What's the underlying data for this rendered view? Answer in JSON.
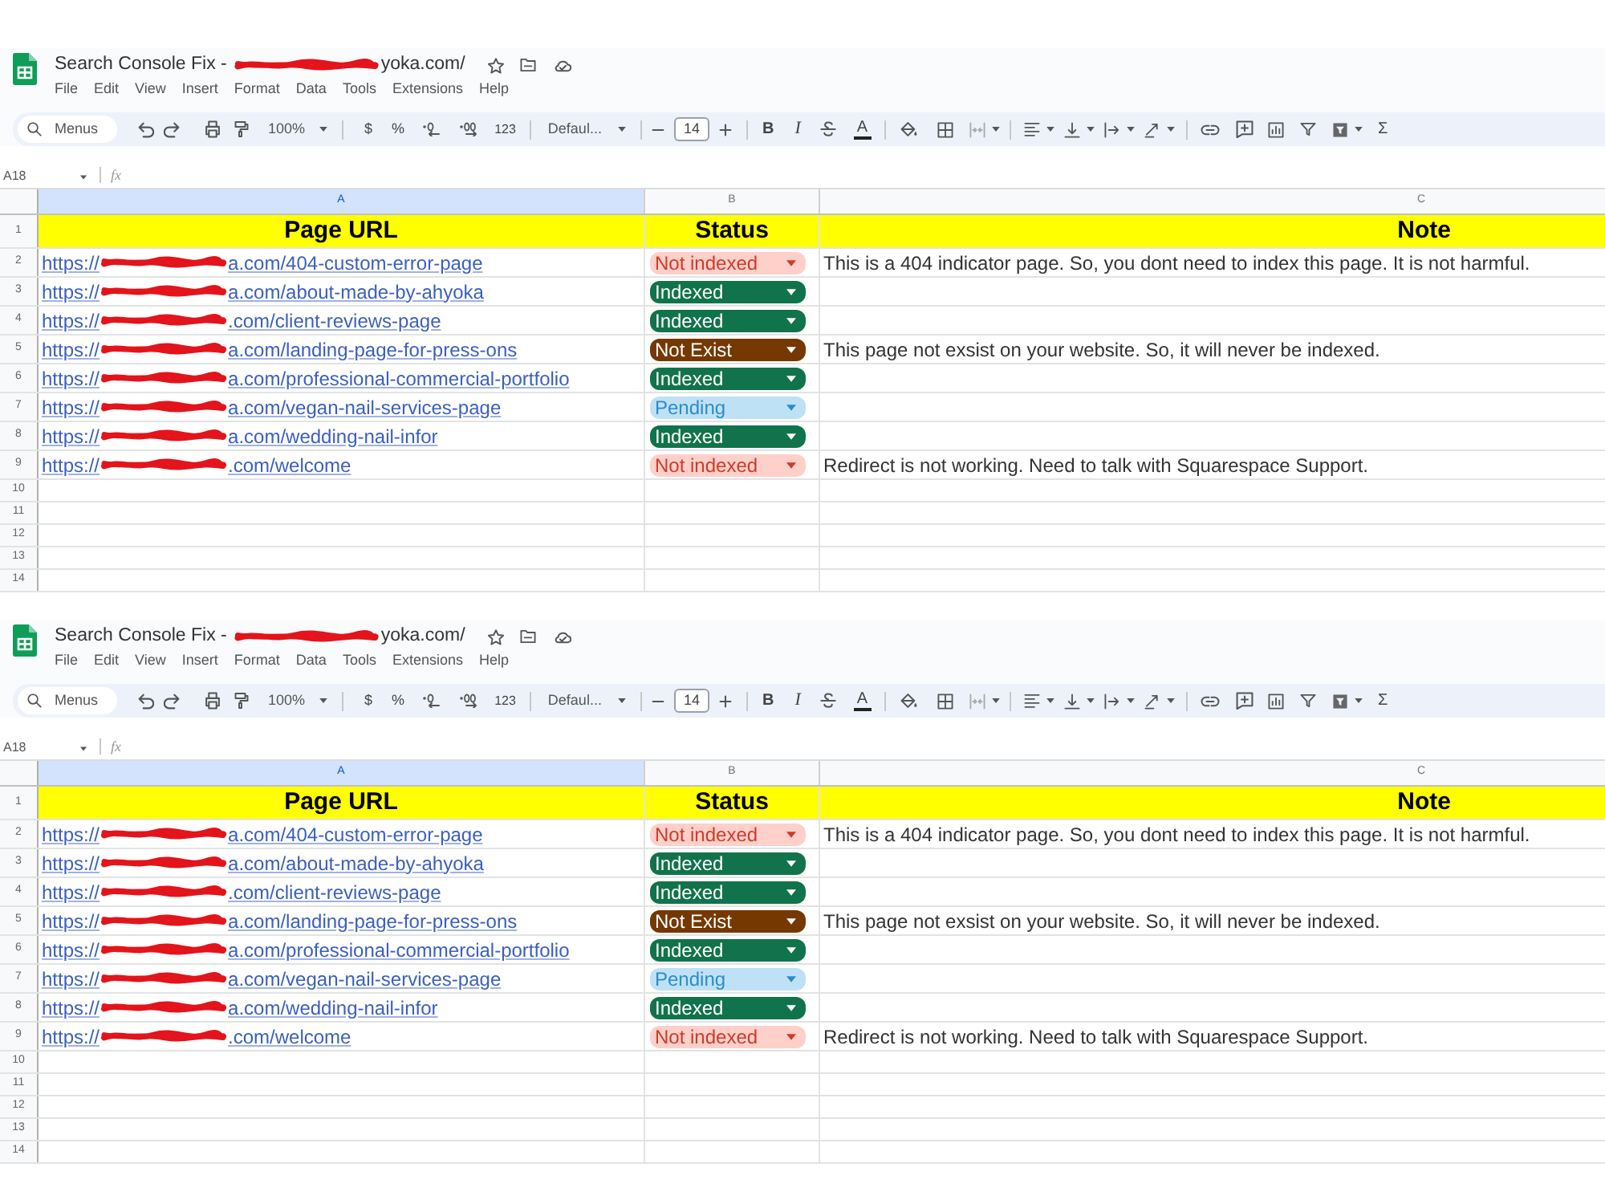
{
  "panes": [
    {
      "title": {
        "prefix": "Search Console Fix -",
        "suffix": "yoka.com/"
      },
      "menu": [
        "File",
        "Edit",
        "View",
        "Insert",
        "Format",
        "Data",
        "Tools",
        "Extensions",
        "Help"
      ],
      "toolbar": {
        "search": "Menus",
        "zoom": "100%",
        "currency": "$",
        "percent": "%",
        "number_format": "123",
        "font": "Defaul...",
        "font_size": "14",
        "bold": "B",
        "italic": "I",
        "text_color": "A",
        "sum": "Σ"
      },
      "formula_bar": {
        "cell": "A18",
        "label": "fx"
      },
      "column_headers": [
        {
          "label": "A",
          "selected": true
        },
        {
          "label": "B",
          "selected": false
        },
        {
          "label": "C",
          "selected": false
        }
      ],
      "header_row": {
        "number": "1",
        "cells": [
          "Page URL",
          "Status",
          "Note"
        ]
      },
      "rows": [
        {
          "number": "2",
          "url": {
            "prefix": "https://",
            "suffix": "a.com/404-custom-error-page"
          },
          "status": {
            "label": "Not indexed",
            "color": "#ffcfc9"
          },
          "note": "This is a 404 indicator page. So, you dont need to index this page. It is not harmful."
        },
        {
          "number": "3",
          "url": {
            "prefix": "https://",
            "suffix": "a.com/about-made-by-ahyoka"
          },
          "status": {
            "label": "Indexed",
            "color": "#11734b"
          }
        },
        {
          "number": "4",
          "url": {
            "prefix": "https://",
            "suffix": ".com/client-reviews-page"
          },
          "status": {
            "label": "Indexed",
            "color": "#11734b"
          }
        },
        {
          "number": "5",
          "url": {
            "prefix": "https://",
            "suffix": "a.com/landing-page-for-press-ons"
          },
          "status": {
            "label": "Not Exist",
            "color": "#753800"
          },
          "note": "This page not exsist on your website. So, it will never be indexed."
        },
        {
          "number": "6",
          "url": {
            "prefix": "https://",
            "suffix": "a.com/professional-commercial-portfolio"
          },
          "status": {
            "label": "Indexed",
            "color": "#11734b"
          }
        },
        {
          "number": "7",
          "url": {
            "prefix": "https://",
            "suffix": "a.com/vegan-nail-services-page"
          },
          "status": {
            "label": "Pending",
            "color": "#bfe1f6"
          }
        },
        {
          "number": "8",
          "url": {
            "prefix": "https://",
            "suffix": "a.com/wedding-nail-infor"
          },
          "status": {
            "label": "Indexed",
            "color": "#11734b"
          }
        },
        {
          "number": "9",
          "url": {
            "prefix": "https://",
            "suffix": ".com/welcome"
          },
          "status": {
            "label": "Not indexed",
            "color": "#ffcfc9"
          },
          "note": "Redirect is not working. Need to talk with Squarespace Support."
        }
      ],
      "empty_rows": [
        "10",
        "11",
        "12",
        "13",
        "14"
      ]
    },
    {
      "title": {
        "prefix": "Search Console Fix -",
        "suffix": "yoka.com/"
      },
      "menu": [
        "File",
        "Edit",
        "View",
        "Insert",
        "Format",
        "Data",
        "Tools",
        "Extensions",
        "Help"
      ],
      "toolbar": {
        "search": "Menus",
        "zoom": "100%",
        "currency": "$",
        "percent": "%",
        "number_format": "123",
        "font": "Defaul...",
        "font_size": "14",
        "bold": "B",
        "italic": "I",
        "text_color": "A",
        "sum": "Σ"
      },
      "formula_bar": {
        "cell": "A18",
        "label": "fx"
      },
      "column_headers": [
        {
          "label": "A",
          "selected": true
        },
        {
          "label": "B",
          "selected": false
        },
        {
          "label": "C",
          "selected": false
        }
      ],
      "header_row": {
        "number": "1",
        "cells": [
          "Page URL",
          "Status",
          "Note"
        ]
      },
      "rows": [
        {
          "number": "2",
          "url": {
            "prefix": "https://",
            "suffix": "a.com/404-custom-error-page"
          },
          "status": {
            "label": "Not indexed",
            "color": "#ffcfc9"
          },
          "note": "This is a 404 indicator page. So, you dont need to index this page. It is not harmful."
        },
        {
          "number": "3",
          "url": {
            "prefix": "https://",
            "suffix": "a.com/about-made-by-ahyoka"
          },
          "status": {
            "label": "Indexed",
            "color": "#11734b"
          }
        },
        {
          "number": "4",
          "url": {
            "prefix": "https://",
            "suffix": ".com/client-reviews-page"
          },
          "status": {
            "label": "Indexed",
            "color": "#11734b"
          }
        },
        {
          "number": "5",
          "url": {
            "prefix": "https://",
            "suffix": "a.com/landing-page-for-press-ons"
          },
          "status": {
            "label": "Not Exist",
            "color": "#753800"
          },
          "note": "This page not exsist on your website. So, it will never be indexed."
        },
        {
          "number": "6",
          "url": {
            "prefix": "https://",
            "suffix": "a.com/professional-commercial-portfolio"
          },
          "status": {
            "label": "Indexed",
            "color": "#11734b"
          }
        },
        {
          "number": "7",
          "url": {
            "prefix": "https://",
            "suffix": "a.com/vegan-nail-services-page"
          },
          "status": {
            "label": "Pending",
            "color": "#bfe1f6"
          }
        },
        {
          "number": "8",
          "url": {
            "prefix": "https://",
            "suffix": "a.com/wedding-nail-infor"
          },
          "status": {
            "label": "Indexed",
            "color": "#11734b"
          }
        },
        {
          "number": "9",
          "url": {
            "prefix": "https://",
            "suffix": ".com/welcome"
          },
          "status": {
            "label": "Not indexed",
            "color": "#ffcfc9"
          },
          "note": "Redirect is not working. Need to talk with Squarespace Support."
        }
      ],
      "empty_rows": [
        "10",
        "11",
        "12",
        "13",
        "14"
      ]
    }
  ]
}
